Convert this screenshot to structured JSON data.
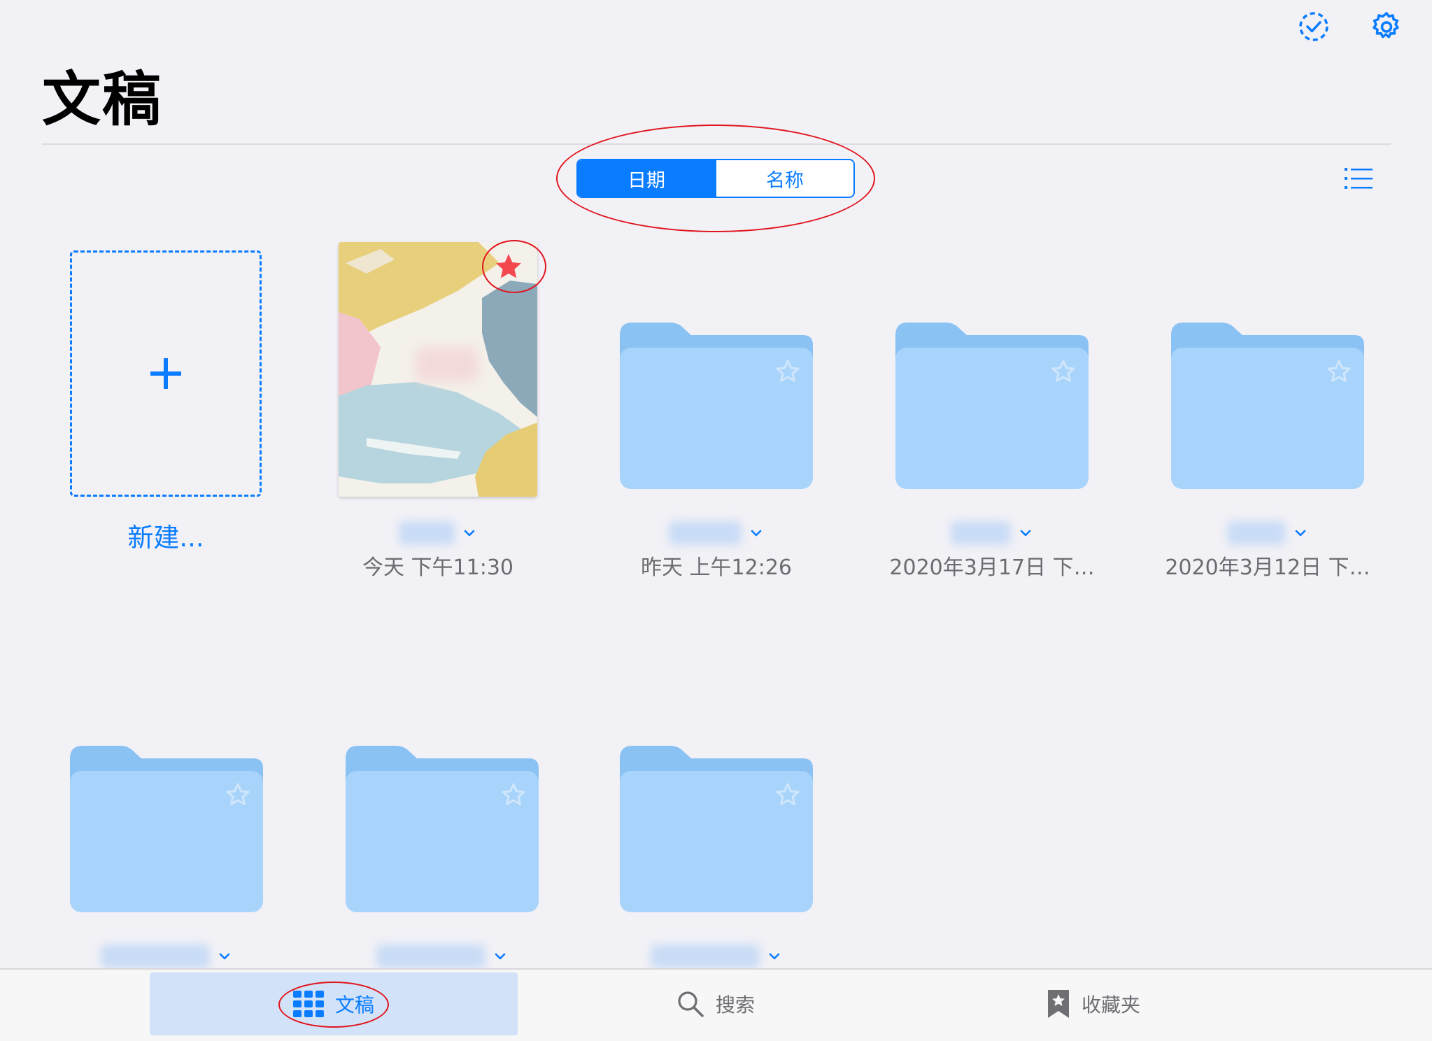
{
  "header": {
    "title": "文稿"
  },
  "sort": {
    "options": [
      {
        "label": "日期",
        "active": true
      },
      {
        "label": "名称",
        "active": false
      }
    ]
  },
  "new_document": {
    "label": "新建..."
  },
  "items": [
    {
      "kind": "document",
      "favorite": true,
      "date": "今天 下午11:30"
    },
    {
      "kind": "folder",
      "favorite": false,
      "date": "昨天 上午12:26"
    },
    {
      "kind": "folder",
      "favorite": false,
      "date": "2020年3月17日 下…"
    },
    {
      "kind": "folder",
      "favorite": false,
      "date": "2020年3月12日 下…"
    },
    {
      "kind": "folder",
      "favorite": false,
      "date": ""
    },
    {
      "kind": "folder",
      "favorite": false,
      "date": ""
    },
    {
      "kind": "folder",
      "favorite": false,
      "date": ""
    }
  ],
  "tabs": [
    {
      "label": "文稿",
      "icon": "grid-icon",
      "active": true
    },
    {
      "label": "搜索",
      "icon": "search-icon",
      "active": false
    },
    {
      "label": "收藏夹",
      "icon": "bookmark-star-icon",
      "active": false
    }
  ],
  "colors": {
    "accent": "#0a7cff",
    "folder_front": "#a8d4fc",
    "folder_back": "#8bc2f4",
    "annotation": "#e0151d",
    "favorite_star": "#f4484f"
  }
}
